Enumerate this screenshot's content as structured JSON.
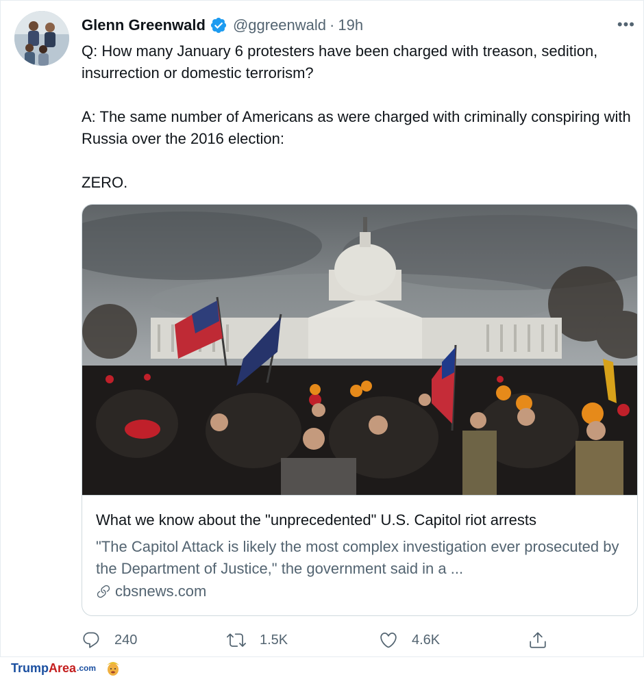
{
  "tweet": {
    "author_name": "Glenn Greenwald",
    "handle": "@ggreenwald",
    "separator": "·",
    "time": "19h",
    "more": "•••",
    "paragraphs": [
      "Q: How many January 6 protesters have been charged with treason, sedition, insurrection or domestic terrorism?",
      "A: The same number of Americans as were charged with criminally conspiring with Russia over the 2016 election:",
      "ZERO."
    ]
  },
  "card": {
    "title": "What we know about the \"unprecedented\" U.S. Capitol riot arrests",
    "description": "\"The Capitol Attack is likely the most complex investigation ever prosecuted by the Department of Justice,\" the government said in a ...",
    "domain": "cbsnews.com"
  },
  "actions": {
    "reply_count": "240",
    "retweet_count": "1.5K",
    "like_count": "4.6K"
  },
  "watermark": {
    "part1": "Trump",
    "part2": "Area",
    "part3": ".com"
  },
  "icons": {
    "verified": "verified-badge-icon",
    "reply": "reply-icon",
    "retweet": "retweet-icon",
    "like": "heart-icon",
    "share": "share-icon",
    "link": "link-icon"
  },
  "colors": {
    "verified_blue": "#1d9bf0",
    "secondary_text": "#536471",
    "primary_text": "#0f1419",
    "border": "#cfd9de"
  }
}
